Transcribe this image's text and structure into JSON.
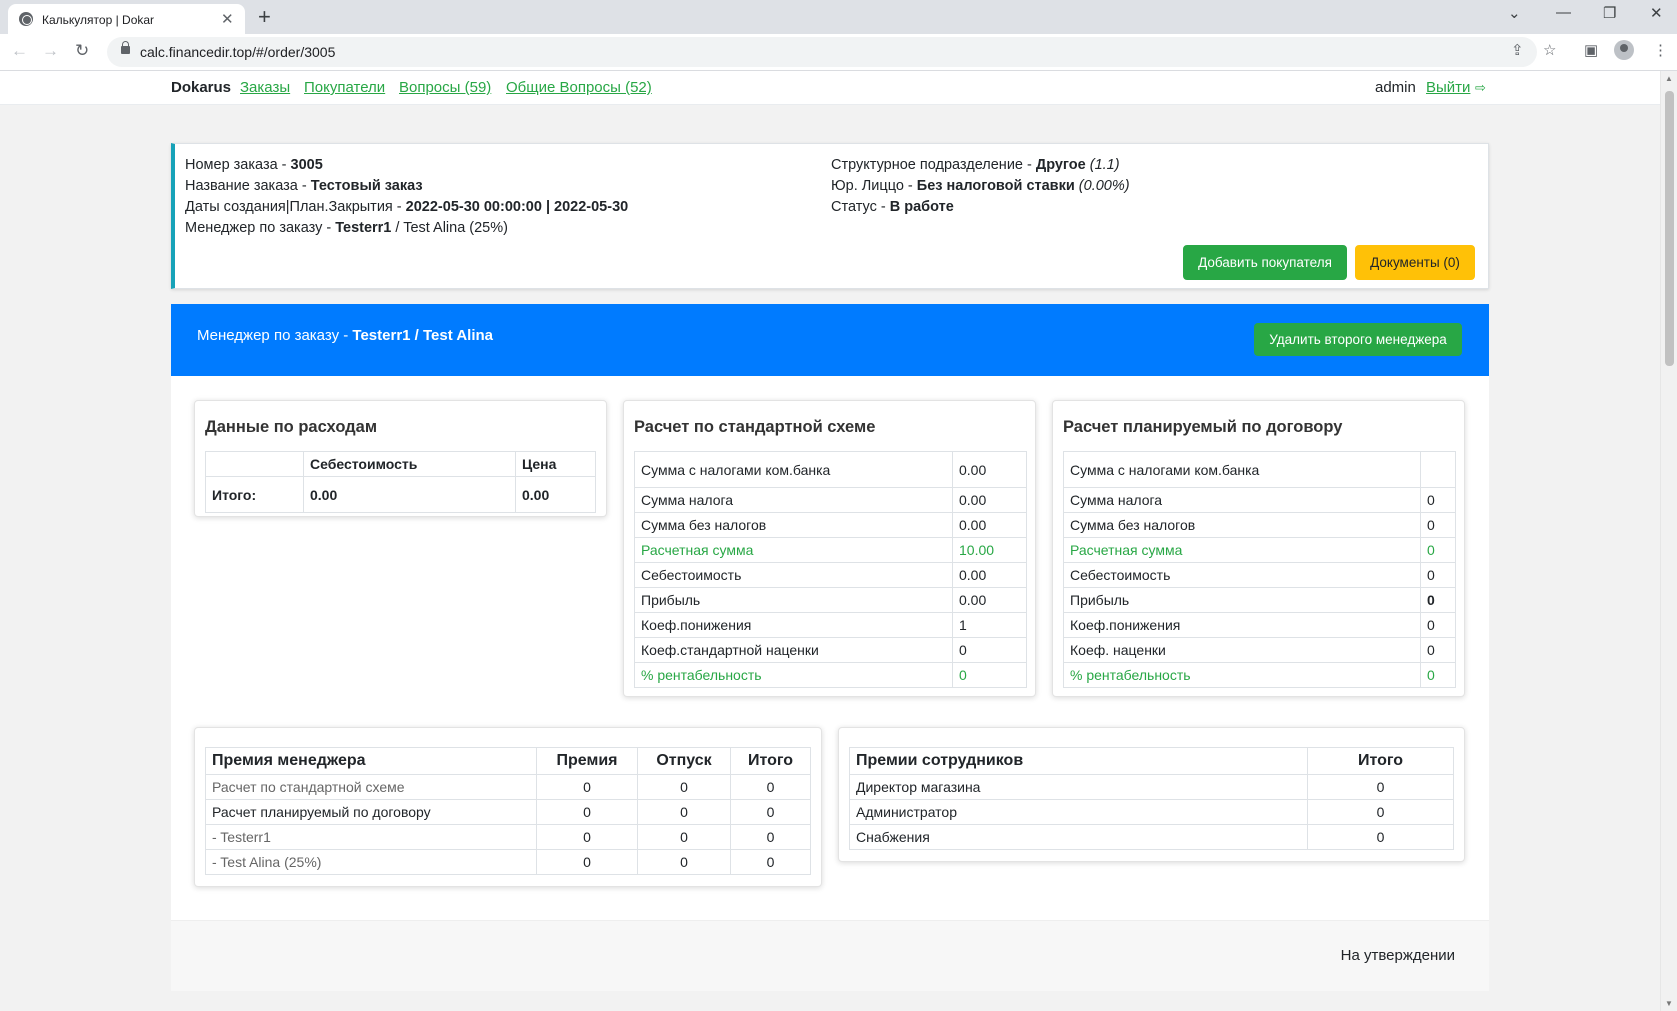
{
  "browser": {
    "tab_title": "Калькулятор | Dokar",
    "url": "calc.financedir.top/#/order/3005"
  },
  "nav": {
    "brand": "Dokarus",
    "links": [
      "Заказы",
      "Покупатели",
      "Вопросы (59)",
      "Общие Вопросы (52)"
    ],
    "user": "admin",
    "logout": "Выйти"
  },
  "order": {
    "number_label": "Номер заказа - ",
    "number": "3005",
    "name_label": "Название заказа - ",
    "name": "Тестовый заказ",
    "dates_label": "Даты создания|План.Закрытия - ",
    "dates": "2022-05-30 00:00:00 | 2022-05-30",
    "manager_label": "Менеджер по заказу - ",
    "manager": "Testerr1",
    "manager_extra": " / Test Alina (25%)",
    "division_label": "Структурное подразделение - ",
    "division": "Другое",
    "division_code": "(1.1)",
    "legal_label": "Юр. Лиццо - ",
    "legal": "Без налоговой ставки",
    "legal_rate": "(0.00%)",
    "status_label": "Статус - ",
    "status": "В работе",
    "add_buyer_button": "Добавить покупателя",
    "documents_button": "Документы (0)"
  },
  "manager_header": {
    "label": "Менеджер по заказу - ",
    "value": "Testerr1 / Test Alina",
    "remove_button": "Удалить второго менеджера"
  },
  "expenses": {
    "title": "Данные по расходам",
    "headers": [
      "",
      "Себестоимость",
      "Цена"
    ],
    "total_label": "Итого:",
    "total_cost": "0.00",
    "total_price": "0.00"
  },
  "standard": {
    "title": "Расчет по стандартной схеме",
    "rows": [
      {
        "label": "Сумма с налогами ком.банка",
        "value": "0.00"
      },
      {
        "label": "Сумма налога",
        "value": "0.00"
      },
      {
        "label": "Сумма без налогов",
        "value": "0.00"
      },
      {
        "label": "Расчетная сумма",
        "value": "10.00"
      },
      {
        "label": "Себестоимость",
        "value": "0.00"
      },
      {
        "label": "Прибыль",
        "value": "0.00"
      },
      {
        "label": "Коеф.понижения",
        "value": "1"
      },
      {
        "label": "Коеф.стандартной наценки",
        "value": "0"
      },
      {
        "label": "% рентабельность",
        "value": "0"
      }
    ]
  },
  "planned": {
    "title": "Расчет планируемый по договору",
    "rows": [
      {
        "label": "Сумма с налогами ком.банка",
        "value": ""
      },
      {
        "label": "Сумма налога",
        "value": "0"
      },
      {
        "label": "Сумма без налогов",
        "value": "0"
      },
      {
        "label": "Расчетная сумма",
        "value": "0"
      },
      {
        "label": "Себестоимость",
        "value": "0"
      },
      {
        "label": "Прибыль",
        "value": "0"
      },
      {
        "label": "Коеф.понижения",
        "value": "0"
      },
      {
        "label": "Коеф. наценки",
        "value": "0"
      },
      {
        "label": "% рентабельность",
        "value": "0"
      }
    ]
  },
  "manager_bonus": {
    "headers": [
      "Премия менеджера",
      "Премия",
      "Отпуск",
      "Итого"
    ],
    "rows": [
      {
        "label": "Расчет по стандартной схеме",
        "bonus": "0",
        "vacation": "0",
        "total": "0"
      },
      {
        "label": "Расчет планируемый по договору",
        "bonus": "0",
        "vacation": "0",
        "total": "0"
      },
      {
        "label": "- Testerr1",
        "bonus": "0",
        "vacation": "0",
        "total": "0"
      },
      {
        "label": "- Test Alina (25%)",
        "bonus": "0",
        "vacation": "0",
        "total": "0"
      }
    ]
  },
  "staff_bonus": {
    "headers": [
      "Премии сотрудников",
      "Итого"
    ],
    "rows": [
      {
        "label": "Директор магазина",
        "total": "0"
      },
      {
        "label": "Администратор",
        "total": "0"
      },
      {
        "label": "Снабжения",
        "total": "0"
      }
    ]
  },
  "footer": {
    "status": "На утверждении"
  }
}
